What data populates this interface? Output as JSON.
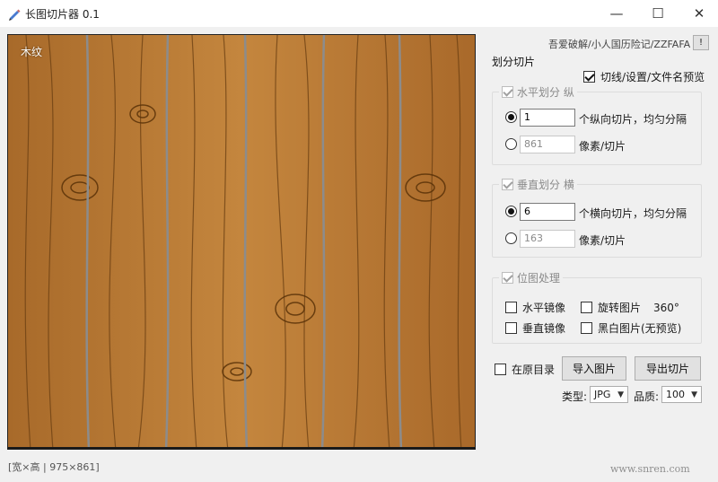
{
  "window": {
    "title": "长图切片器 0.1",
    "controls": {
      "minimize": "—",
      "maximize": "☐",
      "close": "✕"
    }
  },
  "preview": {
    "label": "木纹"
  },
  "status": {
    "text": "[宽×高 | 975×861]"
  },
  "header_link": {
    "text": "吾爱破解/小人国历险记/ZZFAFA",
    "button": "!"
  },
  "panel": {
    "title": "划分切片",
    "show_preview": {
      "label": "切线/设置/文件名预览",
      "checked": true
    }
  },
  "horizontal": {
    "legend": "水平划分 纵",
    "count_value": "1",
    "count_label": "个纵向切片，均匀分隔",
    "pixel_value": "861",
    "pixel_label": "像素/切片"
  },
  "vertical": {
    "legend": "垂直划分 横",
    "count_value": "6",
    "count_label": "个横向切片，均匀分隔",
    "pixel_value": "163",
    "pixel_label": "像素/切片"
  },
  "bitmap": {
    "legend": "位图处理",
    "h_mirror": "水平镜像",
    "rotate": "旋转图片",
    "rotate_value": "360°",
    "v_mirror": "垂直镜像",
    "grayscale": "黑白图片(无预览)"
  },
  "actions": {
    "in_source_dir": "在原目录",
    "import": "导入图片",
    "export": "导出切片",
    "type_label": "类型:",
    "type_value": "JPG",
    "quality_label": "品质:",
    "quality_value": "100"
  },
  "watermark": "www.snren.com",
  "colors": {
    "wood": "#b87a35",
    "wood_dark": "#6b3f12",
    "seam": "#8c8c8c"
  }
}
